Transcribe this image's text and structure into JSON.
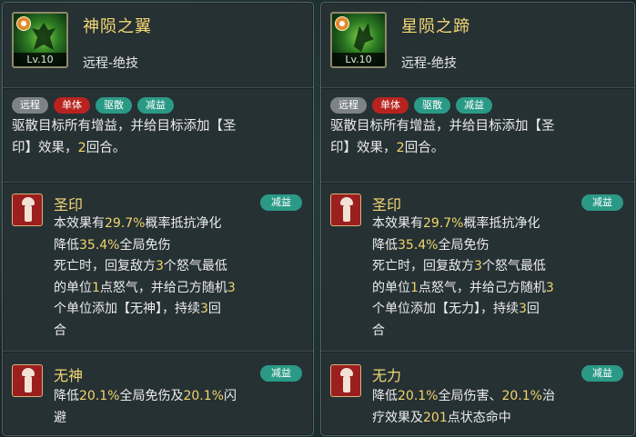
{
  "colors": {
    "gold": "#f4d774",
    "highlight": "#f1d46c",
    "tag_gray": "#7c8388",
    "tag_red": "#b8231f",
    "tag_teal": "#2a9a86"
  },
  "cards": [
    {
      "skill_name": "神陨之翼",
      "level": "Lv.10",
      "skill_type": "远程-绝技",
      "tags": [
        "远程",
        "单体",
        "驱散",
        "减益"
      ],
      "desc": {
        "line1": "驱散目标所有增益，并给目标添加【圣",
        "line2a": "印】效果，",
        "line2n": "2",
        "line2b": "回合。"
      },
      "effects": [
        {
          "icon": "seal-effect-icon",
          "name": "圣印",
          "tag": "减益",
          "l1a": "本效果有",
          "l1n": "29.7%",
          "l1b": "概率抵抗净化",
          "l2a": "降低",
          "l2n": "35.4%",
          "l2b": "全局免伤",
          "l3a": "死亡时，回复敌方",
          "l3n": "3",
          "l3b": "个怒气最低",
          "l4a": "的单位",
          "l4n": "1",
          "l4b": "点怒气，并给己方随机",
          "l4n2": "3",
          "l5a": "个单位添加【无神】，持续",
          "l5n": "3",
          "l5b": "回",
          "l6": "合"
        },
        {
          "icon": "no-spirit-effect-icon",
          "name": "无神",
          "tag": "减益",
          "l1a": "降低",
          "l1n": "20.1%",
          "l1b": "全局免伤及",
          "l1n2": "20.1%",
          "l1c": "闪",
          "l2": "避"
        }
      ]
    },
    {
      "skill_name": "星陨之蹄",
      "level": "Lv.10",
      "skill_type": "远程-绝技",
      "tags": [
        "远程",
        "单体",
        "驱散",
        "减益"
      ],
      "desc": {
        "line1": "驱散目标所有增益，并给目标添加【圣",
        "line2a": "印】效果，",
        "line2n": "2",
        "line2b": "回合。"
      },
      "effects": [
        {
          "icon": "seal-effect-icon",
          "name": "圣印",
          "tag": "减益",
          "l1a": "本效果有",
          "l1n": "29.7%",
          "l1b": "概率抵抗净化",
          "l2a": "降低",
          "l2n": "35.4%",
          "l2b": "全局免伤",
          "l3a": "死亡时，回复敌方",
          "l3n": "3",
          "l3b": "个怒气最低",
          "l4a": "的单位",
          "l4n": "1",
          "l4b": "点怒气，并给己方随机",
          "l4n2": "3",
          "l5a": "个单位添加【无力】，持续",
          "l5n": "3",
          "l5b": "回",
          "l6": "合"
        },
        {
          "icon": "weakness-effect-icon",
          "name": "无力",
          "tag": "减益",
          "l1a": "降低",
          "l1n": "20.1%",
          "l1b": "全局伤害、",
          "l1n2": "20.1%",
          "l1c": "治",
          "l2a": "疗效果及",
          "l2n": "201",
          "l2b": "点状态命中"
        }
      ]
    }
  ]
}
